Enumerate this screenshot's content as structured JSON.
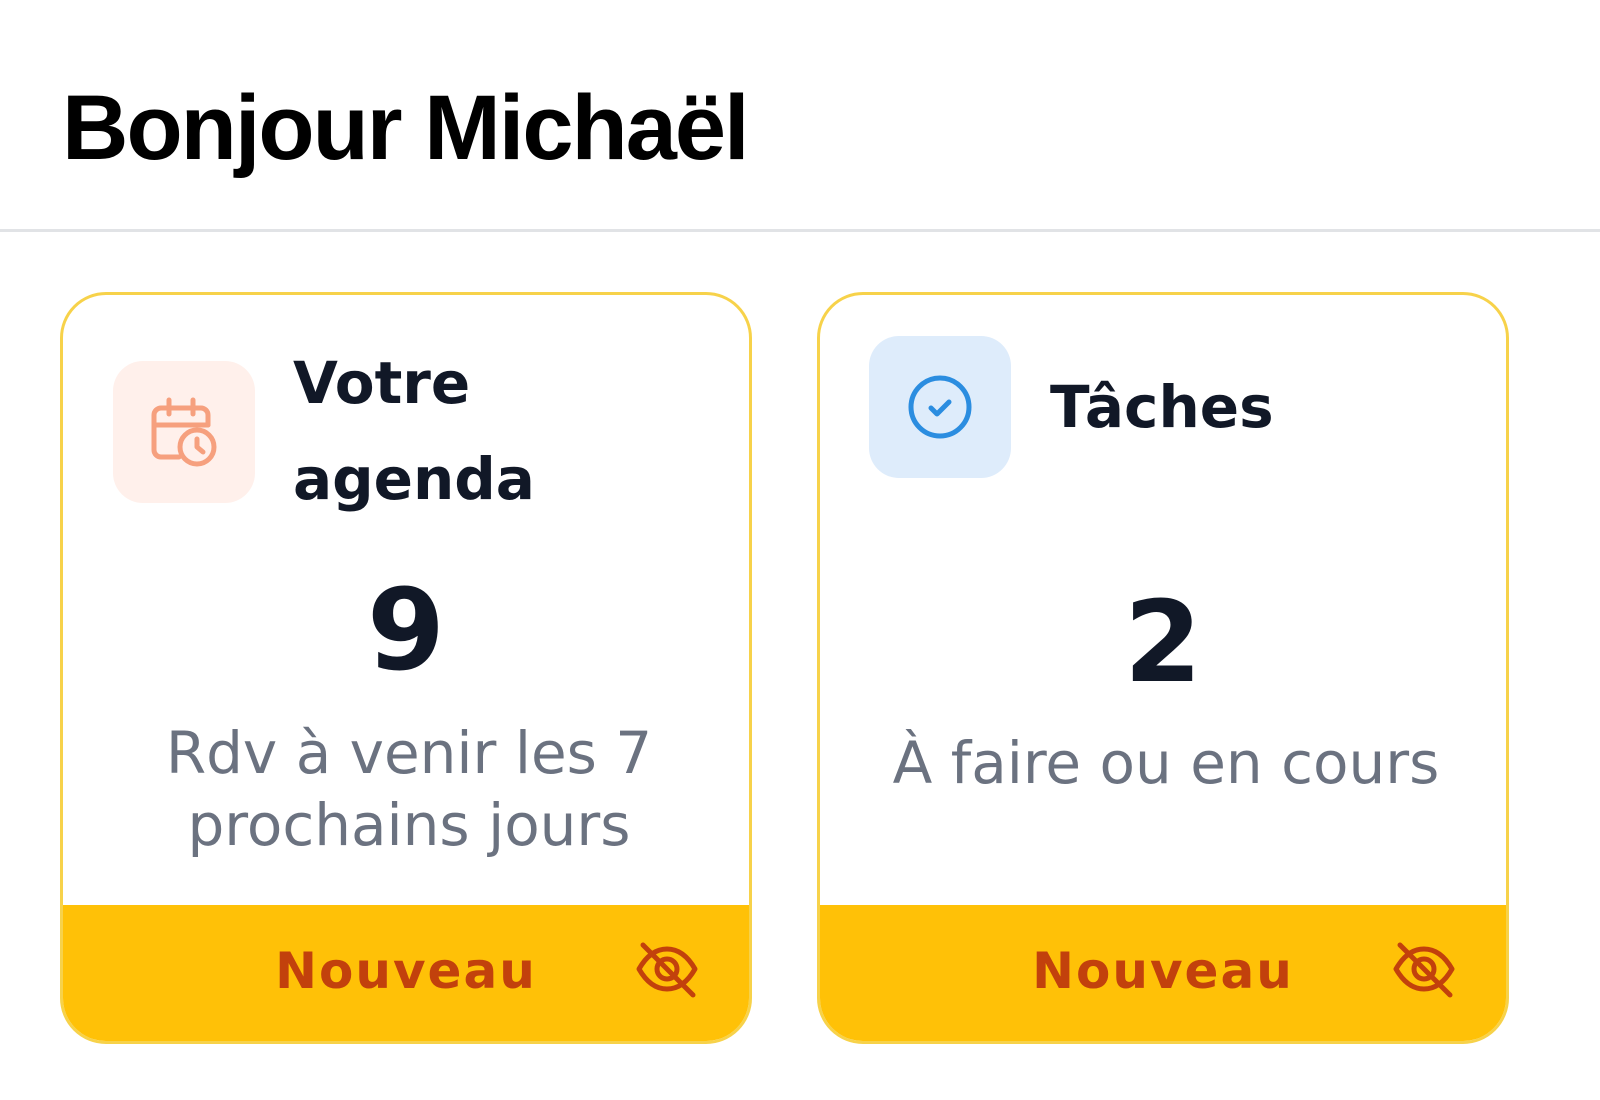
{
  "header": {
    "greeting": "Bonjour Michaël"
  },
  "cards": [
    {
      "title": "Votre agenda",
      "icon": "calendar-clock-icon",
      "value": "9",
      "description": "Rdv à venir les 7 prochains jours",
      "footer_label": "Nouveau",
      "footer_icon": "eye-off-icon"
    },
    {
      "title": "Tâches",
      "icon": "check-circle-icon",
      "value": "2",
      "description": "À faire ou en cours",
      "footer_label": "Nouveau",
      "footer_icon": "eye-off-icon"
    }
  ],
  "colors": {
    "card_border": "#f7d24a",
    "footer_bg": "#ffc107",
    "footer_text": "#c2410c",
    "agenda_icon": "#f6a07e",
    "agenda_icon_bg": "#fff0eb",
    "tasks_icon": "#2b8de0",
    "tasks_icon_bg": "#deecfb",
    "title_text": "#111827",
    "muted_text": "#6b7280"
  }
}
